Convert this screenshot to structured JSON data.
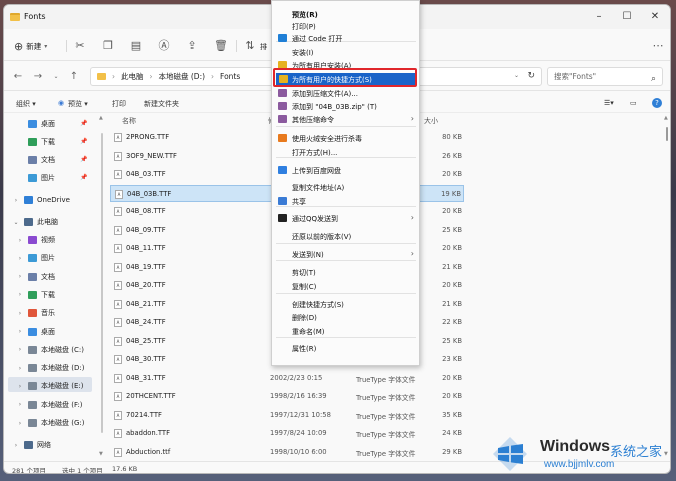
{
  "window": {
    "title": "Fonts"
  },
  "toolbar": {
    "new_label": "新建",
    "overflow_label": "排"
  },
  "address": {
    "crumbs": [
      "此电脑",
      "本地磁盘 (D:)",
      "Fonts"
    ]
  },
  "search": {
    "placeholder": "搜索\"Fonts\""
  },
  "toolbar2": {
    "organize": "组织",
    "preview": "预览",
    "print": "打印",
    "new_folder": "新建文件夹"
  },
  "sidebar": {
    "quick": [
      {
        "label": "桌面",
        "icon": "desktop-icon",
        "color": "#3b8de0"
      },
      {
        "label": "下载",
        "icon": "download-icon",
        "color": "#2f9e5a"
      },
      {
        "label": "文档",
        "icon": "documents-icon",
        "color": "#6b7fa8"
      },
      {
        "label": "图片",
        "icon": "pictures-icon",
        "color": "#3c9ad6"
      }
    ],
    "onedrive": "OneDrive",
    "thispc": "此电脑",
    "pc_items": [
      {
        "label": "视频",
        "icon": "videos-icon",
        "color": "#8a4ad0"
      },
      {
        "label": "图片",
        "icon": "pictures-icon",
        "color": "#3c9ad6"
      },
      {
        "label": "文档",
        "icon": "documents-icon",
        "color": "#6b7fa8"
      },
      {
        "label": "下载",
        "icon": "download-icon",
        "color": "#2f9e5a"
      },
      {
        "label": "音乐",
        "icon": "music-icon",
        "color": "#e0563a"
      },
      {
        "label": "桌面",
        "icon": "desktop-icon",
        "color": "#3b8de0"
      },
      {
        "label": "本地磁盘 (C:)",
        "icon": "drive-icon",
        "color": "#7a8796"
      },
      {
        "label": "本地磁盘 (D:)",
        "icon": "drive-icon",
        "color": "#7a8796"
      },
      {
        "label": "本地磁盘 (E:)",
        "icon": "drive-icon",
        "color": "#7a8796"
      },
      {
        "label": "本地磁盘 (F:)",
        "icon": "drive-icon",
        "color": "#7a8796"
      },
      {
        "label": "本地磁盘 (G:)",
        "icon": "drive-icon",
        "color": "#7a8796"
      }
    ],
    "network": "网络"
  },
  "columns": {
    "name": "名称",
    "date": "修",
    "size": "大小"
  },
  "files": [
    {
      "name": "2PRONG.TTF",
      "date": "",
      "type": "",
      "size": "80 KB"
    },
    {
      "name": "3OF9_NEW.TTF",
      "date": "",
      "type": "",
      "size": "26 KB"
    },
    {
      "name": "04B_03.TTF",
      "date": "",
      "type": "",
      "size": "20 KB"
    },
    {
      "name": "04B_03B.TTF",
      "date": "20",
      "type": "",
      "size": "19 KB"
    },
    {
      "name": "04B_08.TTF",
      "date": "",
      "type": "",
      "size": "20 KB"
    },
    {
      "name": "04B_09.TTF",
      "date": "",
      "type": "",
      "size": "25 KB"
    },
    {
      "name": "04B_11.TTF",
      "date": "",
      "type": "",
      "size": "20 KB"
    },
    {
      "name": "04B_19.TTF",
      "date": "",
      "type": "",
      "size": "21 KB"
    },
    {
      "name": "04B_20.TTF",
      "date": "",
      "type": "",
      "size": "20 KB"
    },
    {
      "name": "04B_21.TTF",
      "date": "",
      "type": "",
      "size": "21 KB"
    },
    {
      "name": "04B_24.TTF",
      "date": "",
      "type": "",
      "size": "22 KB"
    },
    {
      "name": "04B_25.TTF",
      "date": "",
      "type": "",
      "size": "25 KB"
    },
    {
      "name": "04B_30.TTF",
      "date": "",
      "type": "",
      "size": "23 KB"
    },
    {
      "name": "04B_31.TTF",
      "date": "2002/2/23 0:15",
      "type": "TrueType 字体文件",
      "size": "20 KB"
    },
    {
      "name": "20THCENT.TTF",
      "date": "1998/2/16 16:39",
      "type": "TrueType 字体文件",
      "size": "20 KB"
    },
    {
      "name": "70214.TTF",
      "date": "1997/12/31 10:58",
      "type": "TrueType 字体文件",
      "size": "35 KB"
    },
    {
      "name": "abaddon.TTF",
      "date": "1997/8/24 10:09",
      "type": "TrueType 字体文件",
      "size": "24 KB"
    },
    {
      "name": "Abduction.ttf",
      "date": "1998/10/10 6:00",
      "type": "TrueType 字体文件",
      "size": "29 KB"
    }
  ],
  "status": {
    "count": "281 个项目",
    "selected": "选中 1 个项目",
    "size": "17.6 KB"
  },
  "context_menu": {
    "items": [
      {
        "label": "预览(R)",
        "icon": "",
        "bold": true
      },
      {
        "label": "打印(P)",
        "icon": ""
      },
      {
        "label": "通过 Code 打开",
        "icon": "vscode-icon",
        "color": "#1f7fd6"
      },
      {
        "label": "安装(I)",
        "icon": ""
      },
      {
        "label": "为所有用户安装(A)",
        "icon": "shield-icon",
        "color": "#e6b21f"
      },
      {
        "label": "为所有用户的快捷方式(S)",
        "icon": "shield-icon",
        "color": "#e6b21f",
        "highlight": true
      },
      {
        "label": "添加到压缩文件(A)...",
        "icon": "archive-icon",
        "color": "#8b5a9e"
      },
      {
        "label": "添加到 \"04B_03B.zip\" (T)",
        "icon": "archive-icon",
        "color": "#8b5a9e"
      },
      {
        "label": "其他压缩命令",
        "icon": "archive-icon",
        "color": "#8b5a9e",
        "submenu": true
      },
      {
        "label": "使用火绒安全进行杀毒",
        "icon": "huorong-icon",
        "color": "#e87a1e"
      },
      {
        "label": "打开方式(H)...",
        "icon": ""
      },
      {
        "label": "上传到百度网盘",
        "icon": "baidu-cloud-icon",
        "color": "#2f7fe0"
      },
      {
        "label": "复制文件地址(A)",
        "icon": ""
      },
      {
        "label": "共享",
        "icon": "share-icon",
        "color": "#3a7bd5"
      },
      {
        "label": "通过QQ发送到",
        "icon": "qq-icon",
        "color": "#222222",
        "submenu": true
      },
      {
        "label": "还原以前的版本(V)",
        "icon": ""
      },
      {
        "label": "发送到(N)",
        "icon": "",
        "submenu": true
      },
      {
        "label": "剪切(T)",
        "icon": ""
      },
      {
        "label": "复制(C)",
        "icon": ""
      },
      {
        "label": "创建快捷方式(S)",
        "icon": ""
      },
      {
        "label": "删除(D)",
        "icon": ""
      },
      {
        "label": "重命名(M)",
        "icon": ""
      },
      {
        "label": "属性(R)",
        "icon": ""
      }
    ]
  },
  "watermark": {
    "title": "Windows",
    "subtitle": "系统之家",
    "url": "www.bjjmlv.com"
  }
}
